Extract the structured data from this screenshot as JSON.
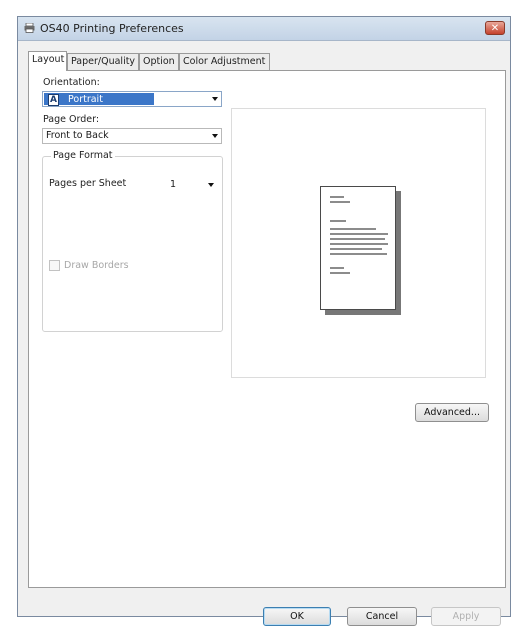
{
  "window": {
    "title": "OS40 Printing Preferences",
    "close_glyph": "✕",
    "icon": "printer-icon"
  },
  "tabs": [
    {
      "label": "Layout",
      "active": true
    },
    {
      "label": "Paper/Quality",
      "active": false
    },
    {
      "label": "Option",
      "active": false
    },
    {
      "label": "Color Adjustment",
      "active": false
    }
  ],
  "layout": {
    "orientation": {
      "label": "Orientation:",
      "value": "Portrait",
      "icon_glyph": "A"
    },
    "page_order": {
      "label": "Page Order:",
      "value": "Front to Back"
    },
    "page_format": {
      "title": "Page Format",
      "pages_per_sheet_label": "Pages per Sheet",
      "pages_per_sheet_value": "1",
      "draw_borders_label": "Draw Borders",
      "draw_borders_checked": false
    },
    "advanced_label": "Advanced..."
  },
  "footer": {
    "ok_label": "OK",
    "cancel_label": "Cancel",
    "apply_label": "Apply"
  },
  "colors": {
    "selection": "#3b76c8",
    "close_button": "#c4422e"
  }
}
